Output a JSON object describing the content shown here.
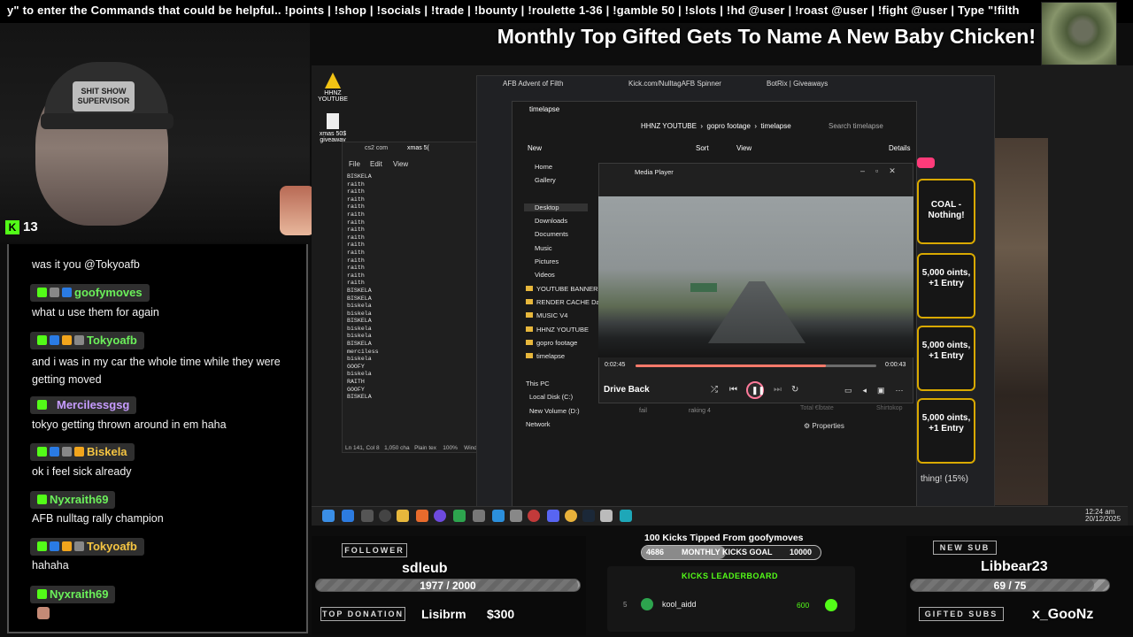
{
  "ticker": "y\" to enter the  Commands that could be helpful..    !points  |  !shop  |  !socials  |  !trade  |  !bounty  |  !roulette 1-36  |  !gamble 50  |  !slots  |  !hd @user  |  !roast @user  |  !fight @user  |  Type \"!filth",
  "banner": "Monthly Top Gifted Gets To Name A New Baby Chicken!",
  "cam": {
    "patch": "SHIT SHOW SUPERVISOR",
    "kick_count": "13"
  },
  "chat": [
    {
      "text": "was it you @Tokyoafb"
    },
    {
      "name": "goofymoves",
      "text": "what u use them for again"
    },
    {
      "name": "Tokyoafb",
      "text": "and i was in my car the whole time while they were getting moved"
    },
    {
      "name": "Mercilessgsg",
      "text": "tokyo getting thrown around in em haha"
    },
    {
      "name": "Biskela",
      "text": "ok i feel sick already"
    },
    {
      "name": "Nyxraith69",
      "text": "AFB nulltag rally champion"
    },
    {
      "name": "Tokyoafb",
      "text": "hahaha"
    },
    {
      "name": "Nyxraith69",
      "text": ""
    }
  ],
  "desktop": {
    "left_icons": [
      "HHNZ YOUTUBE",
      "xmas 50$ giveaway"
    ],
    "notepad": {
      "tabs": [
        "cs2 com",
        "xmas 5("
      ],
      "menu": [
        "File",
        "Edit",
        "View"
      ],
      "lines": "BISKELA\nraith\nraith\nraith\nraith\nraith\nraith\nraith\nraith\nraith\nraith\nraith\nraith\nraith\nraith\nBISKELA\nBISKELA\nbiskela\nbiskela\nBISKELA\nbiskela\nbiskela\nBISKELA\nmerciless\nbiskela\nGOOFY\nbiskela\nRAITH\nGOOFY\nBISKELA",
      "status": [
        "Ln 141, Col 8",
        "1,050 cha",
        "Plain tex",
        "100%",
        "Window"
      ]
    },
    "browser_tabs": [
      "AFB Advent of Filth",
      "Kick.com/NulltagAFB Spinner",
      "BotRix | Giveaways"
    ],
    "explorer": {
      "tab": "timelapse",
      "path": [
        "HHNZ YOUTUBE",
        "gopro footage",
        "timelapse"
      ],
      "search_placeholder": "Search timelapse",
      "toolbar": [
        "New",
        "Sort",
        "View",
        "Details"
      ],
      "nav": [
        "Home",
        "Gallery",
        "Desktop",
        "Downloads",
        "Documents",
        "Music",
        "Pictures",
        "Videos",
        "YOUTUBE BANNER NE",
        "RENDER CACHE DaVi",
        "MUSIC V4",
        "HHNZ YOUTUBE",
        "gopro footage",
        "timelapse",
        "This PC",
        "Local Disk (C:)",
        "New Volume (D:)",
        "Network"
      ],
      "behind": [
        "fail",
        "raking 4",
        "Total €lbtate",
        "Shirtokop"
      ],
      "properties": "Properties"
    },
    "player": {
      "title": "Media Player",
      "elapsed": "0:02:45",
      "remaining": "0:00:43",
      "progress": 0.79,
      "track": "Drive Back"
    },
    "giveaways": [
      {
        "title": "COAL - Nothing!"
      },
      {
        "title": "5,000 oints, +1 Entry"
      },
      {
        "title": "5,000 oints, +1 Entry"
      },
      {
        "title": "5,000 oints, +1 Entry"
      }
    ],
    "giveaway_footer": "thing! (15%)",
    "clock": [
      "12:24 am",
      "20/12/2025"
    ]
  },
  "overlay": {
    "follower_label": "FOLLOWER",
    "follower_name": "sdleub",
    "follower_progress": "1977 / 2000",
    "follower_ratio": 0.9885,
    "kicks_tipped": "100 Kicks Tipped From goofymoves",
    "kicks_current": "4686",
    "kicks_goal_label": "MONTHLY KICKS GOAL",
    "kicks_goal": "10000",
    "leaderboard_title": "KICKS LEADERBOARD",
    "leaderboard_rank": "5",
    "leaderboard_user": "kool_aidd",
    "leaderboard_value": "600",
    "top_donation_label": "TOP DONATION",
    "top_donation_name": "Lisibrm",
    "top_donation_amount": "$300",
    "new_sub_label": "NEW SUB",
    "new_sub_name": "Libbear23",
    "sub_progress": "69 / 75",
    "sub_ratio": 0.92,
    "gifted_label": "GIFTED SUBS",
    "gifted_name": "x_GooNz"
  },
  "colors": {
    "kick_green": "#53fc18",
    "gold": "#d9a900",
    "accent": "#ff7a6a"
  }
}
